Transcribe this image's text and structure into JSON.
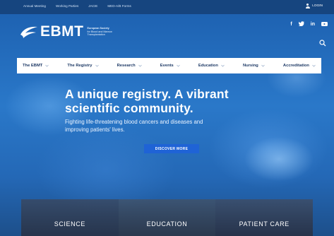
{
  "topbar": {
    "links": [
      "Annual Meeting",
      "Working Parties",
      "JACIE",
      "MED-A/B Forms"
    ],
    "login_label": "LOGIN"
  },
  "header": {
    "logo_text": "EBMT",
    "logo_subtitle": [
      "European Society",
      "for Blood and Marrow",
      "Transplantation"
    ],
    "social": [
      "f",
      "t",
      "in",
      "yt"
    ]
  },
  "nav": {
    "items": [
      {
        "label": "The EBMT"
      },
      {
        "label": "The Registry"
      },
      {
        "label": "Research"
      },
      {
        "label": "Events"
      },
      {
        "label": "Education"
      },
      {
        "label": "Nursing"
      },
      {
        "label": "Accreditation"
      }
    ]
  },
  "hero": {
    "title_line1": "A unique registry. A vibrant",
    "title_line2": "scientific community.",
    "subtitle_line1": "Fighting life-threatening blood cancers and diseases and",
    "subtitle_line2": "improving patients' lives.",
    "cta_label": "DISCOVER MORE"
  },
  "cards": [
    {
      "label": "SCIENCE"
    },
    {
      "label": "EDUCATION"
    },
    {
      "label": "PATIENT CARE"
    }
  ],
  "colors": {
    "topbar": "#16457f",
    "nav_text": "#1e3a66",
    "cta": "#1f63d6"
  }
}
